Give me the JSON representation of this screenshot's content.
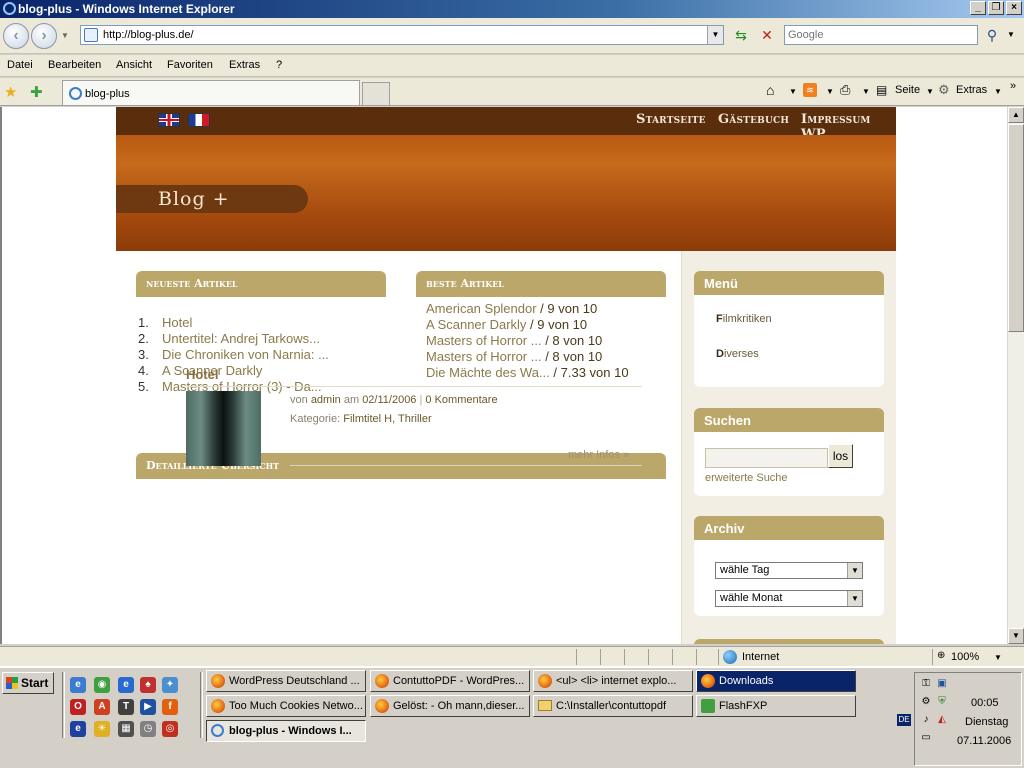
{
  "window": {
    "title": "blog-plus - Windows Internet Explorer"
  },
  "nav": {
    "url": "http://blog-plus.de/",
    "search_placeholder": "Google"
  },
  "menubar": [
    "Datei",
    "Bearbeiten",
    "Ansicht",
    "Favoriten",
    "Extras",
    "?"
  ],
  "tabs": {
    "active_label": "blog-plus"
  },
  "commandbar": {
    "seite": "Seite",
    "extras": "Extras"
  },
  "site": {
    "topnav": [
      "Startseite",
      "Gästebuch",
      "Impressum WP"
    ],
    "blog_title": "Blog +",
    "newest": {
      "heading": "neueste Artikel",
      "items": [
        {
          "num": "1.",
          "title": "Hotel"
        },
        {
          "num": "2.",
          "title": "Untertitel: Andrej Tarkows..."
        },
        {
          "num": "3.",
          "title": "Die Chroniken von Narnia: ..."
        },
        {
          "num": "4.",
          "title": "A Scanner Darkly"
        },
        {
          "num": "5.",
          "title": "Masters of Horror (3) - Da..."
        }
      ]
    },
    "best": {
      "heading": "beste Artikel",
      "items": [
        {
          "title": "American Splendor",
          "score": " / 9 von 10"
        },
        {
          "title": "A Scanner Darkly",
          "score": " / 9 von 10"
        },
        {
          "title": "Masters of Horror ...",
          "score": " / 8 von 10"
        },
        {
          "title": "Masters of Horror ...",
          "score": " / 8 von 10"
        },
        {
          "title": "Die Mächte des Wa...",
          "score": " / 7.33 von 10"
        }
      ]
    },
    "overview_heading": "Detaillierte Übersicht",
    "post": {
      "title": "Hotel",
      "von": "von",
      "author": "admin",
      "am": "am",
      "date": "02/11/2006",
      "sep": "|",
      "comments": "0 Kommentare",
      "category_label": "Kategorie:",
      "categories": "Filmtitel H, Thriller",
      "more": "mehr Infos  »"
    },
    "sidebar": {
      "menu_heading": "Menü",
      "menu_items": [
        {
          "first": "F",
          "rest": "ilmkritiken"
        },
        {
          "first": "D",
          "rest": "iverses"
        }
      ],
      "search_heading": "Suchen",
      "search_button": "los",
      "advanced_search": "erweiterte Suche",
      "archive_heading": "Archiv",
      "select_day": "wähle Tag",
      "select_month": "wähle Monat"
    }
  },
  "status": {
    "zone": "Internet",
    "zoom": "100%"
  },
  "taskbar": {
    "start": "Start",
    "row1": [
      "WordPress Deutschland ...",
      "ContuttoPDF - WordPres...",
      "<ul> <li> internet explo...",
      "Downloads"
    ],
    "row2": [
      "Too Much Cookies Netwo...",
      "Gelöst: - Oh mann,dieser...",
      "C:\\Installer\\contuttopdf",
      "FlashFXP"
    ],
    "row3": [
      "blog-plus - Windows I..."
    ],
    "lang": "DE",
    "time": "00:05",
    "day": "Dienstag",
    "date": "07.11.2006"
  },
  "colors": {
    "accent": "#bba76a",
    "banner": "#c66a1c",
    "topbar": "#5a2e0c"
  }
}
